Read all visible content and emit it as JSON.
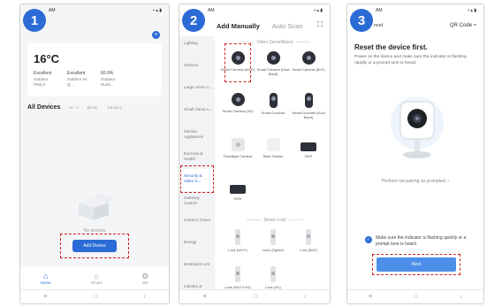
{
  "steps": [
    "1",
    "2",
    "3"
  ],
  "status_time": "AM",
  "nav": {
    "menu": "≡",
    "home": "□",
    "back": "‹"
  },
  "phone1": {
    "temperature": "16°C",
    "metrics": [
      {
        "value": "Excellent",
        "label": "Outdoor PM2.5"
      },
      {
        "value": "Excellent",
        "label": "Outdoor Air Q..."
      },
      {
        "value": "60.0%",
        "label": "Outdoor Humi..."
      }
    ],
    "all_devices": "All Devices",
    "rooms": [
      "Ar·· t",
      "Ba·an·",
      "Ka·an·s"
    ],
    "no_devices": "No devices",
    "add_device": "Add Device",
    "tabs": [
      {
        "label": "Home",
        "icon": "home-icon"
      },
      {
        "label": "Smart",
        "icon": "sun-icon"
      },
      {
        "label": "Me",
        "icon": "settings-icon"
      }
    ]
  },
  "phone2": {
    "tab_active": "Add Manually",
    "tab_inactive": "Auto Scan",
    "categories": [
      "Lighting",
      "Sensors",
      "Large Home A...",
      "Small Home A...",
      "Kitchen Appliances",
      "Exercise & Health",
      "Security & Video S...",
      "Gateway Control",
      "Outdoor Travel",
      "Energy",
      "Entertainm ent",
      "Industry & Agriculture"
    ],
    "section_video": "Video Surveillance",
    "video_devices": [
      "Smart Camera (Wi-Fi)",
      "Smart Camera (Dual Band)",
      "Smart Camera (BLE)",
      "Smart Camera (4G)",
      "Smart Doorbell",
      "Smart Doorbell (Dual Band)",
      "Floodlight Camera",
      "Base Station",
      "NVR",
      "DVR"
    ],
    "section_lock": "Smart Lock",
    "lock_devices": [
      "Lock (Wi-Fi)",
      "Lock (Zigbee)",
      "Lock (BLE)",
      "Lock (Wi-Fi+4G)",
      "Lock (4G)"
    ]
  },
  "phone3": {
    "cancel": "ncel",
    "qr_code": "QR Code ≈",
    "title": "Reset the device first.",
    "description": "Power on the device and make sure the indicator is flashing rapidly or a prompt tone is heard.",
    "pairing_link": "Perform net pairing as prompted. ›",
    "confirm": "Make sure the indicator is flashing quickly or a prompt tone is heard",
    "next": "Next"
  }
}
